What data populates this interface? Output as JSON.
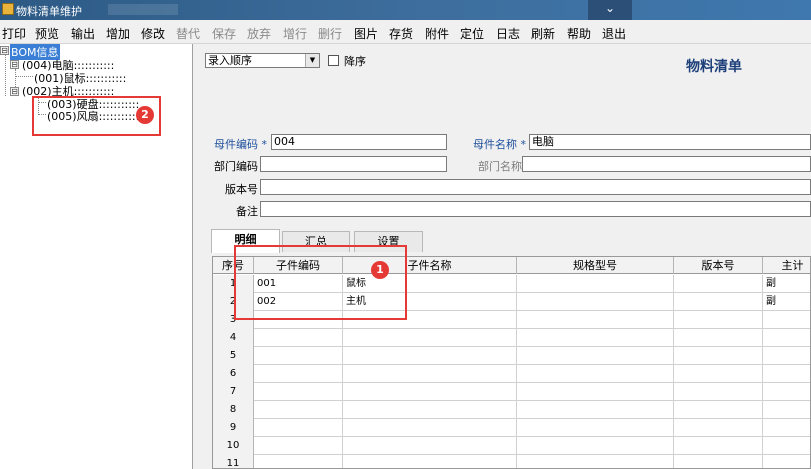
{
  "window": {
    "title": "物料清单维护",
    "minimize_glyph": "⌄"
  },
  "menu": {
    "items": [
      {
        "label": "打印",
        "enabled": true
      },
      {
        "label": "预览",
        "enabled": true
      },
      {
        "label": "输出",
        "enabled": true
      },
      {
        "label": "增加",
        "enabled": true
      },
      {
        "label": "修改",
        "enabled": true
      },
      {
        "label": "替代",
        "enabled": false
      },
      {
        "label": "保存",
        "enabled": false
      },
      {
        "label": "放弃",
        "enabled": false
      },
      {
        "label": "增行",
        "enabled": false
      },
      {
        "label": "删行",
        "enabled": false
      },
      {
        "label": "图片",
        "enabled": true
      },
      {
        "label": "存货",
        "enabled": true
      },
      {
        "label": "附件",
        "enabled": true
      },
      {
        "label": "定位",
        "enabled": true
      },
      {
        "label": "日志",
        "enabled": true
      },
      {
        "label": "刷新",
        "enabled": true
      },
      {
        "label": "帮助",
        "enabled": true
      },
      {
        "label": "退出",
        "enabled": true
      }
    ]
  },
  "tree": {
    "root": {
      "label": "BOM信息",
      "toggle": "⊟"
    },
    "nodes": [
      {
        "label": "(004)电脑:::::::::::",
        "toggle": "⊟"
      },
      {
        "label": "(001)鼠标:::::::::::",
        "toggle": ""
      },
      {
        "label": "(002)主机:::::::::::",
        "toggle": "⊟"
      },
      {
        "label": "(003)硬盘:::::::::::",
        "toggle": ""
      },
      {
        "label": "(005)风扇:::::::::::",
        "toggle": ""
      }
    ]
  },
  "annotations": [
    {
      "label": "1"
    },
    {
      "label": "2"
    }
  ],
  "form": {
    "sort_select": {
      "value": "录入顺序",
      "arrow": "▼"
    },
    "descending_label": "降序",
    "descending_checked": false,
    "title": "物料清单",
    "required_mark": "*",
    "parent_code": {
      "label": "母件编码",
      "value": "004"
    },
    "parent_name": {
      "label": "母件名称",
      "value": "电脑"
    },
    "dept_code": {
      "label": "部门编码",
      "value": ""
    },
    "dept_name": {
      "label": "部门名称",
      "value": ""
    },
    "version": {
      "label": "版本号",
      "value": ""
    },
    "remark": {
      "label": "备注",
      "value": ""
    }
  },
  "tabs": [
    {
      "label": "明细",
      "active": true
    },
    {
      "label": "汇总",
      "active": false
    },
    {
      "label": "设置",
      "active": false
    }
  ],
  "grid": {
    "columns": [
      "序号",
      "子件编码",
      "子件名称",
      "规格型号",
      "版本号",
      "主计"
    ],
    "rows": [
      {
        "num": "1",
        "code": "001",
        "name": "鼠标",
        "spec": "",
        "version": "",
        "main": "副"
      },
      {
        "num": "2",
        "code": "002",
        "name": "主机",
        "spec": "",
        "version": "",
        "main": "副"
      },
      {
        "num": "3",
        "code": "",
        "name": "",
        "spec": "",
        "version": "",
        "main": ""
      },
      {
        "num": "4",
        "code": "",
        "name": "",
        "spec": "",
        "version": "",
        "main": ""
      },
      {
        "num": "5",
        "code": "",
        "name": "",
        "spec": "",
        "version": "",
        "main": ""
      },
      {
        "num": "6",
        "code": "",
        "name": "",
        "spec": "",
        "version": "",
        "main": ""
      },
      {
        "num": "7",
        "code": "",
        "name": "",
        "spec": "",
        "version": "",
        "main": ""
      },
      {
        "num": "8",
        "code": "",
        "name": "",
        "spec": "",
        "version": "",
        "main": ""
      },
      {
        "num": "9",
        "code": "",
        "name": "",
        "spec": "",
        "version": "",
        "main": ""
      },
      {
        "num": "10",
        "code": "",
        "name": "",
        "spec": "",
        "version": "",
        "main": ""
      },
      {
        "num": "11",
        "code": "",
        "name": "",
        "spec": "",
        "version": "",
        "main": ""
      }
    ]
  }
}
